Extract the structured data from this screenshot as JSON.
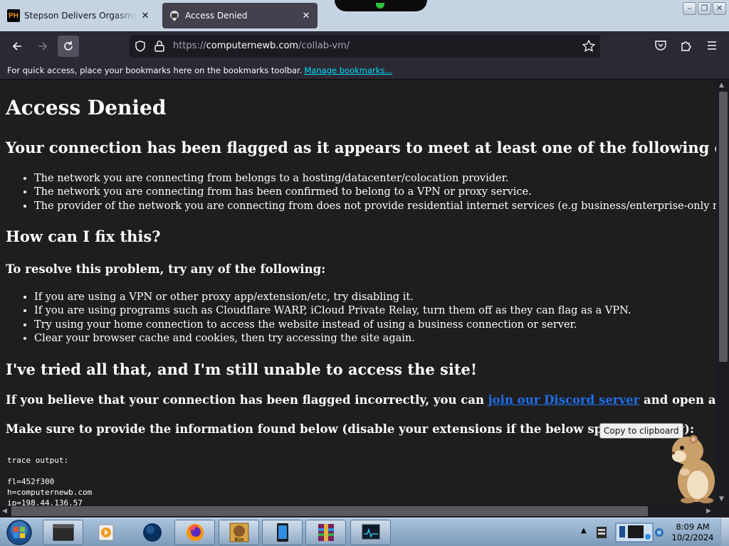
{
  "tabs": [
    {
      "title": "Stepson Delivers Orgasms to his",
      "favicon": "PH",
      "active": false
    },
    {
      "title": "Access Denied",
      "active": true
    }
  ],
  "nav": {
    "url_scheme": "https://",
    "url_host": "computernewb.com",
    "url_path": "/collab-vm/"
  },
  "bookmarks_bar": {
    "message": "For quick access, place your bookmarks here on the bookmarks toolbar.",
    "link": "Manage bookmarks..."
  },
  "page": {
    "title": "Access Denied",
    "flagged_heading": "Your connection has been flagged as it appears to meet at least one of the following criteria:",
    "criteria": [
      "The network you are connecting from belongs to a hosting/datacenter/colocation provider.",
      "The network you are connecting from has been confirmed to belong to a VPN or proxy service.",
      "The provider of the network you are connecting from does not provide residential internet services (e.g business/enterprise-only networks)."
    ],
    "fix_heading": "How can I fix this?",
    "resolve_heading": "To resolve this problem, try any of the following:",
    "resolve_steps": [
      "If you are using a VPN or other proxy app/extension/etc, try disabling it.",
      "If you are using programs such as Cloudflare WARP, iCloud Private Relay, turn them off as they can flag as a VPN.",
      "Try using your home connection to access the website instead of using a business connection or server.",
      "Clear your browser cache and cookies, then try accessing the site again."
    ],
    "tried_heading": "I've tried all that, and I'm still unable to access the site!",
    "discord_prefix": "If you believe that your connection has been flagged incorrectly, you can ",
    "discord_link": "join our Discord server",
    "discord_suffix": " and open a ticket.",
    "info_text": "Make sure to provide the information found below (disable your extensions if the below space is empty):",
    "copy_button": "Copy to clipboard",
    "trace_lines": [
      "trace output:",
      "",
      "fl=452f300",
      "h=computernewb.com",
      "ip=198.44.136.57"
    ]
  },
  "taskbar": {
    "time": "8:09 AM",
    "date": "10/2/2024",
    "items": [
      "explorer-window",
      "media-player",
      "globe",
      "firefox",
      "game-box",
      "tablet",
      "winrar",
      "monitor"
    ]
  },
  "colors": {
    "page_bg": "#1e1e1e",
    "toolbar_bg": "#2b2a33",
    "link": "#1f6feb",
    "bookmark_link": "#00ddff"
  }
}
